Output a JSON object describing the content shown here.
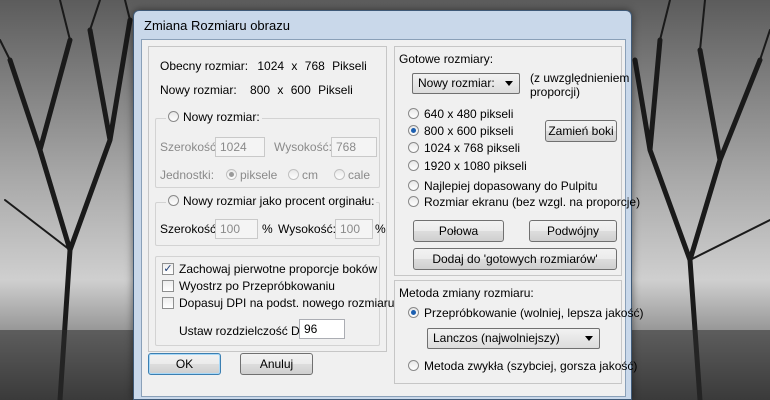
{
  "window": {
    "title": "Zmiana Rozmiaru obrazu"
  },
  "current_size": {
    "label": "Obecny rozmiar:",
    "width": "1024",
    "x": "x",
    "height": "768",
    "unit": "Pikseli"
  },
  "new_size_info": {
    "label": "Nowy rozmiar:",
    "width": "800",
    "x": "x",
    "height": "600",
    "unit": "Pikseli"
  },
  "new_size_group": {
    "radio_label": "Nowy rozmiar:",
    "width_label": "Szerokość:",
    "width_value": "1024",
    "height_label": "Wysokość:",
    "height_value": "768",
    "units_label": "Jednostki:",
    "units": [
      "piksele",
      "cm",
      "cale"
    ]
  },
  "percent_group": {
    "radio_label": "Nowy rozmiar jako procent orginału:",
    "width_label": "Szerokość:",
    "width_value": "100",
    "width_unit": "%",
    "height_label": "Wysokość:",
    "height_value": "100",
    "height_unit": "%"
  },
  "options": {
    "keep_ratio": "Zachowaj pierwotne proporcje boków",
    "sharpen": "Wyostrz po Przepróbkowaniu",
    "fit_dpi": "Dopasuj DPI na podst. nowego rozmiaru",
    "dpi_label": "Ustaw rozdzielczość DPI:",
    "dpi_value": "96"
  },
  "buttons": {
    "ok": "OK",
    "cancel": "Anuluj"
  },
  "presets": {
    "title": "Gotowe rozmiary:",
    "dropdown": "Nowy rozmiar:",
    "note_line1": "(z uwzględnieniem",
    "note_line2": "proporcji)",
    "sizes": [
      "640 x 480 pikseli",
      "800 x 600 pikseli",
      "1024 x 768 pikseli",
      "1920 x 1080 pikseli"
    ],
    "swap_button": "Zamień boki",
    "best_fit": "Najlepiej dopasowany do Pulpitu",
    "screen_size": "Rozmiar ekranu  (bez wzgl. na proporcje)",
    "half_button": "Połowa",
    "double_button": "Podwójny",
    "add_button": "Dodaj do 'gotowych rozmiarów'"
  },
  "method": {
    "title": "Metoda zmiany rozmiaru:",
    "resample": "Przepróbkowanie (wolniej, lepsza jakość)",
    "filter": "Lanczos  (najwolniejszy)",
    "simple": "Metoda zwykła (szybciej, gorsza jakość)"
  },
  "colors": {
    "window_frame": "#c9d8ea",
    "dialog_bg": "#f0f0f0",
    "accent": "#1c5fb0"
  }
}
